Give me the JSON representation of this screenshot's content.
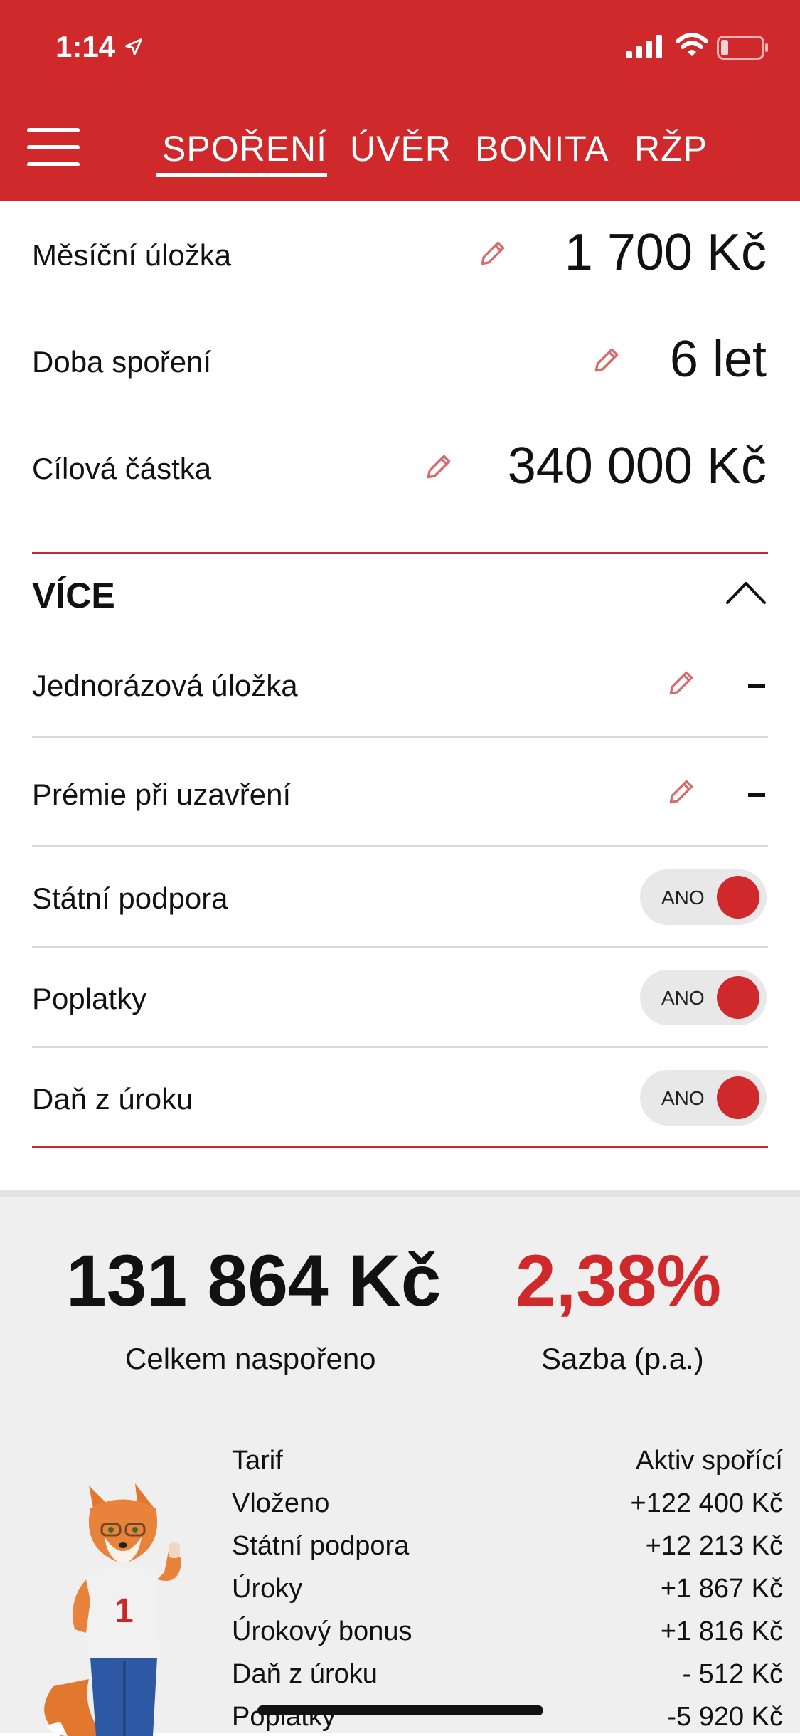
{
  "status_bar": {
    "time": "1:14"
  },
  "tabs": [
    {
      "label": "SPOŘENÍ"
    },
    {
      "label": "ÚVĚR"
    },
    {
      "label": "BONITA"
    },
    {
      "label": "RŽP"
    }
  ],
  "inputs": {
    "monthly_deposit": {
      "label": "Měsíční úložka",
      "value": "1 700 Kč"
    },
    "saving_period": {
      "label": "Doba spoření",
      "value": "6 let"
    },
    "target_amount": {
      "label": "Cílová částka",
      "value": "340 000 Kč"
    }
  },
  "more": {
    "title": "VÍCE",
    "one_time_deposit": {
      "label": "Jednorázová úložka",
      "value": "-"
    },
    "closing_premium": {
      "label": "Prémie při uzavření",
      "value": "-"
    },
    "state_support": {
      "label": "Státní podpora",
      "toggle": "ANO",
      "on": true
    },
    "fees": {
      "label": "Poplatky",
      "toggle": "ANO",
      "on": true
    },
    "interest_tax": {
      "label": "Daň z úroku",
      "toggle": "ANO",
      "on": true
    }
  },
  "results": {
    "total_saved": "131 864 Kč",
    "total_saved_caption": "Celkem naspořeno",
    "rate": "2,38%",
    "rate_caption": "Sazba (p.a.)",
    "summary": [
      {
        "label": "Tarif",
        "value": "Aktiv spořící"
      },
      {
        "label": "Vloženo",
        "value": "+122 400 Kč"
      },
      {
        "label": "Státní podpora",
        "value": "+12 213 Kč"
      },
      {
        "label": "Úroky",
        "value": "+1 867 Kč"
      },
      {
        "label": "Úrokový bonus",
        "value": "+1 816 Kč"
      },
      {
        "label": "Daň z úroku",
        "value": "- 512 Kč"
      },
      {
        "label": "Poplatky",
        "value": "-5 920 Kč"
      }
    ]
  },
  "colors": {
    "brand_red": "#d0292b",
    "background_grey": "#efefef"
  }
}
